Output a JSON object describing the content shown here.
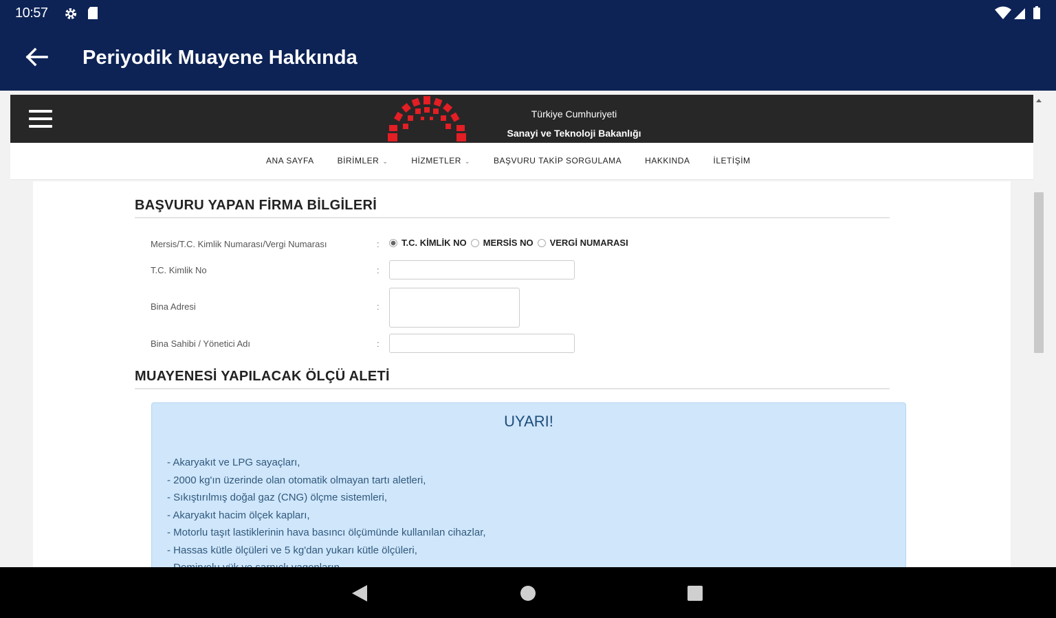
{
  "status_bar": {
    "time": "10:57",
    "left_icons": [
      "gear-icon",
      "sd-card-icon"
    ],
    "right_icons": [
      "wifi-icon",
      "signal-icon",
      "battery-icon"
    ]
  },
  "app_bar": {
    "back_icon": "arrow-left-icon",
    "title": "Periyodik Muayene Hakkında",
    "color": "#0d2356"
  },
  "site": {
    "header": {
      "line1": "Türkiye Cumhuriyeti",
      "line2": "Sanayi ve Teknoloji Bakanlığı",
      "brand_color": "#e31e24"
    },
    "nav": [
      {
        "label": "ANA SAYFA",
        "dropdown": false
      },
      {
        "label": "BİRİMLER",
        "dropdown": true
      },
      {
        "label": "HİZMETLER",
        "dropdown": true
      },
      {
        "label": "BAŞVURU TAKİP SORGULAMA",
        "dropdown": false
      },
      {
        "label": "HAKKINDA",
        "dropdown": false
      },
      {
        "label": "İLETİŞİM",
        "dropdown": false
      }
    ]
  },
  "form": {
    "section1_title": "BAŞVURU YAPAN FİRMA BİLGİLERİ",
    "id_type_label": "Mersis/T.C. Kimlik Numarası/Vergi Numarası",
    "id_type_options": [
      {
        "label": "T.C. KİMLİK NO",
        "checked": true
      },
      {
        "label": "MERSİS NO",
        "checked": false
      },
      {
        "label": "VERGİ NUMARASI",
        "checked": false
      }
    ],
    "tc_label": "T.C. Kimlik No",
    "tc_value": "",
    "address_label": "Bina Adresi",
    "address_value": "",
    "owner_label": "Bina Sahibi / Yönetici Adı",
    "owner_value": "",
    "colon": ":",
    "section2_title": "MUAYENESİ YAPILACAK ÖLÇÜ ALETİ"
  },
  "alert": {
    "title": "UYARI!",
    "items": [
      "- Akaryakıt ve LPG sayaçları,",
      "- 2000 kg'ın üzerinde olan otomatik olmayan tartı aletleri,",
      "- Sıkıştırılmış doğal gaz (CNG) ölçme sistemleri,",
      "- Akaryakıt hacim ölçek kapları,",
      "- Motorlu taşıt lastiklerinin hava basıncı ölçümünde kullanılan cihazlar,",
      "- Hassas kütle ölçüleri ve 5 kg'dan yukarı kütle ölçüleri,",
      "- Demiryolu yük ve sarnıçlı vagonların"
    ]
  }
}
